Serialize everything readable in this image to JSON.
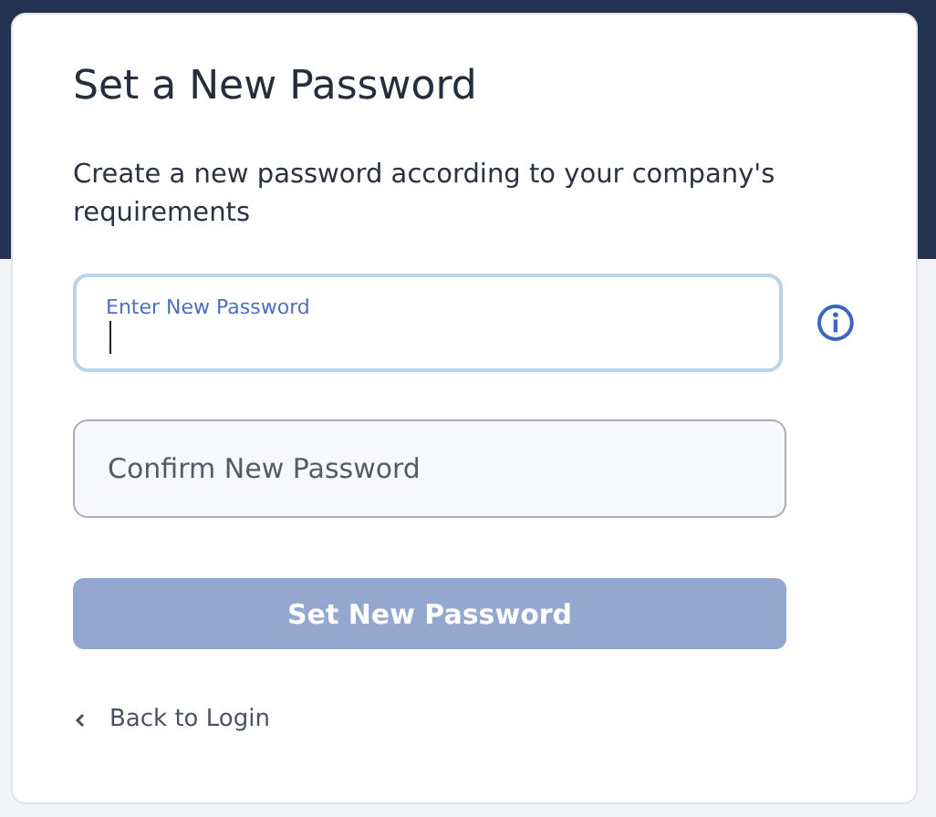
{
  "title": "Set a New Password",
  "description": "Create a new password according to your company's requirements",
  "fields": [
    {
      "label": "Enter New Password",
      "focused": true,
      "info_icon": true
    },
    {
      "label": "Confirm New Password",
      "focused": false,
      "info_icon": false
    }
  ],
  "submit_button": {
    "label": "Set New Password",
    "disabled": true
  },
  "back_link": {
    "label": "Back to Login"
  }
}
